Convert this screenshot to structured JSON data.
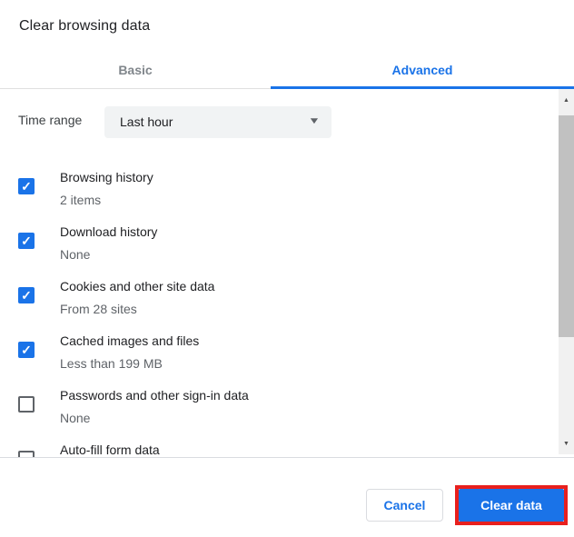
{
  "title": "Clear browsing data",
  "tabs": [
    {
      "label": "Basic",
      "active": false
    },
    {
      "label": "Advanced",
      "active": true
    }
  ],
  "time_range": {
    "label": "Time range",
    "selected": "Last hour"
  },
  "checkbox_rows": [
    {
      "label": "Browsing history",
      "sublabel": "2 items",
      "checked": true
    },
    {
      "label": "Download history",
      "sublabel": "None",
      "checked": true
    },
    {
      "label": "Cookies and other site data",
      "sublabel": "From 28 sites",
      "checked": true
    },
    {
      "label": "Cached images and files",
      "sublabel": "Less than 199 MB",
      "checked": true
    },
    {
      "label": "Passwords and other sign-in data",
      "sublabel": "None",
      "checked": false
    },
    {
      "label": "Auto-fill form data",
      "sublabel": "",
      "checked": false
    }
  ],
  "footer": {
    "cancel_label": "Cancel",
    "confirm_label": "Clear data"
  },
  "icons": {
    "check": "✓",
    "caret_down": "▼",
    "scroll_up": "▲",
    "scroll_down": "▼"
  },
  "colors": {
    "accent_blue": "#1a73e8",
    "annotation_red": "#e8201e",
    "primary_text": "#202124",
    "secondary_text": "#5f6368",
    "inactive_tab_text": "#80868b",
    "dropdown_bg": "#f1f3f4",
    "divider": "#dadce0",
    "scrollbar_track": "#f1f1f1",
    "scrollbar_thumb": "#c1c1c1"
  }
}
